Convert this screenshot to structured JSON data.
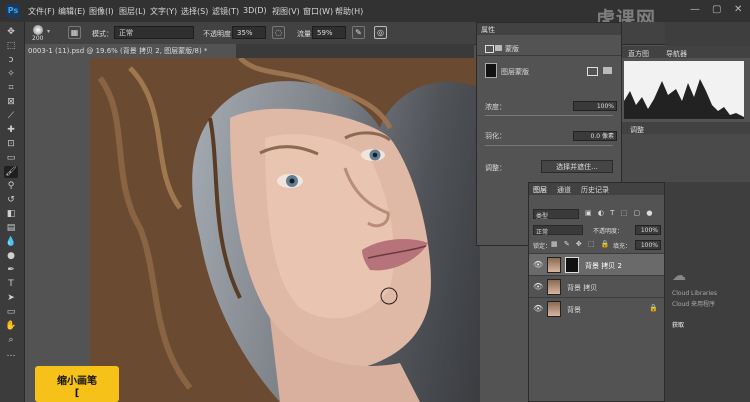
{
  "menu": {
    "logo": "Ps",
    "items": [
      "文件(F)",
      "编辑(E)",
      "图像(I)",
      "图层(L)",
      "文字(Y)",
      "选择(S)",
      "滤镜(T)",
      "3D(D)",
      "视图(V)",
      "窗口(W)",
      "帮助(H)"
    ]
  },
  "watermark": "虎课网",
  "window_controls": {
    "minimize": "—",
    "maximize": "▢",
    "close": "✕"
  },
  "options": {
    "brush_size": "200",
    "mode_label": "模式：",
    "mode_value": "正常",
    "opacity_label": "不透明度：",
    "opacity_value": "35%",
    "flow_label": "流量：",
    "flow_value": "59%"
  },
  "document_tab": "0003-1 (11).psd @ 19.6% (背景 拷贝 2, 图层蒙版/8) *",
  "properties": {
    "tab": "属性",
    "mask_label": "蒙版",
    "layer_mask_label": "图层蒙版",
    "density_label": "浓度：",
    "density_value": "100%",
    "feather_label": "羽化：",
    "feather_value": "0.0 像素",
    "refine_label": "调整：",
    "select_mask_button": "选择并遮住..."
  },
  "navigator": {
    "tab_histogram": "直方图",
    "tab_navigator": "导航器"
  },
  "adjust": {
    "tab": "调整"
  },
  "layers": {
    "tabs": [
      "图层",
      "通道",
      "历史记录"
    ],
    "filter_type": "类型",
    "blend_mode": "正常",
    "opacity_label": "不透明度：",
    "opacity_value": "100%",
    "lock_label": "锁定：",
    "fill_label": "填充：",
    "fill_value": "100%",
    "rows": [
      {
        "name": "背景 拷贝 2",
        "selected": true
      },
      {
        "name": "背景 拷贝",
        "selected": false
      },
      {
        "name": "背景",
        "selected": false
      }
    ]
  },
  "cloud": {
    "line1": "Cloud Libraries",
    "line2": "Cloud 来用程序",
    "line3": "获取"
  },
  "tooltip": {
    "title": "缩小画笔",
    "shortcut": "["
  }
}
